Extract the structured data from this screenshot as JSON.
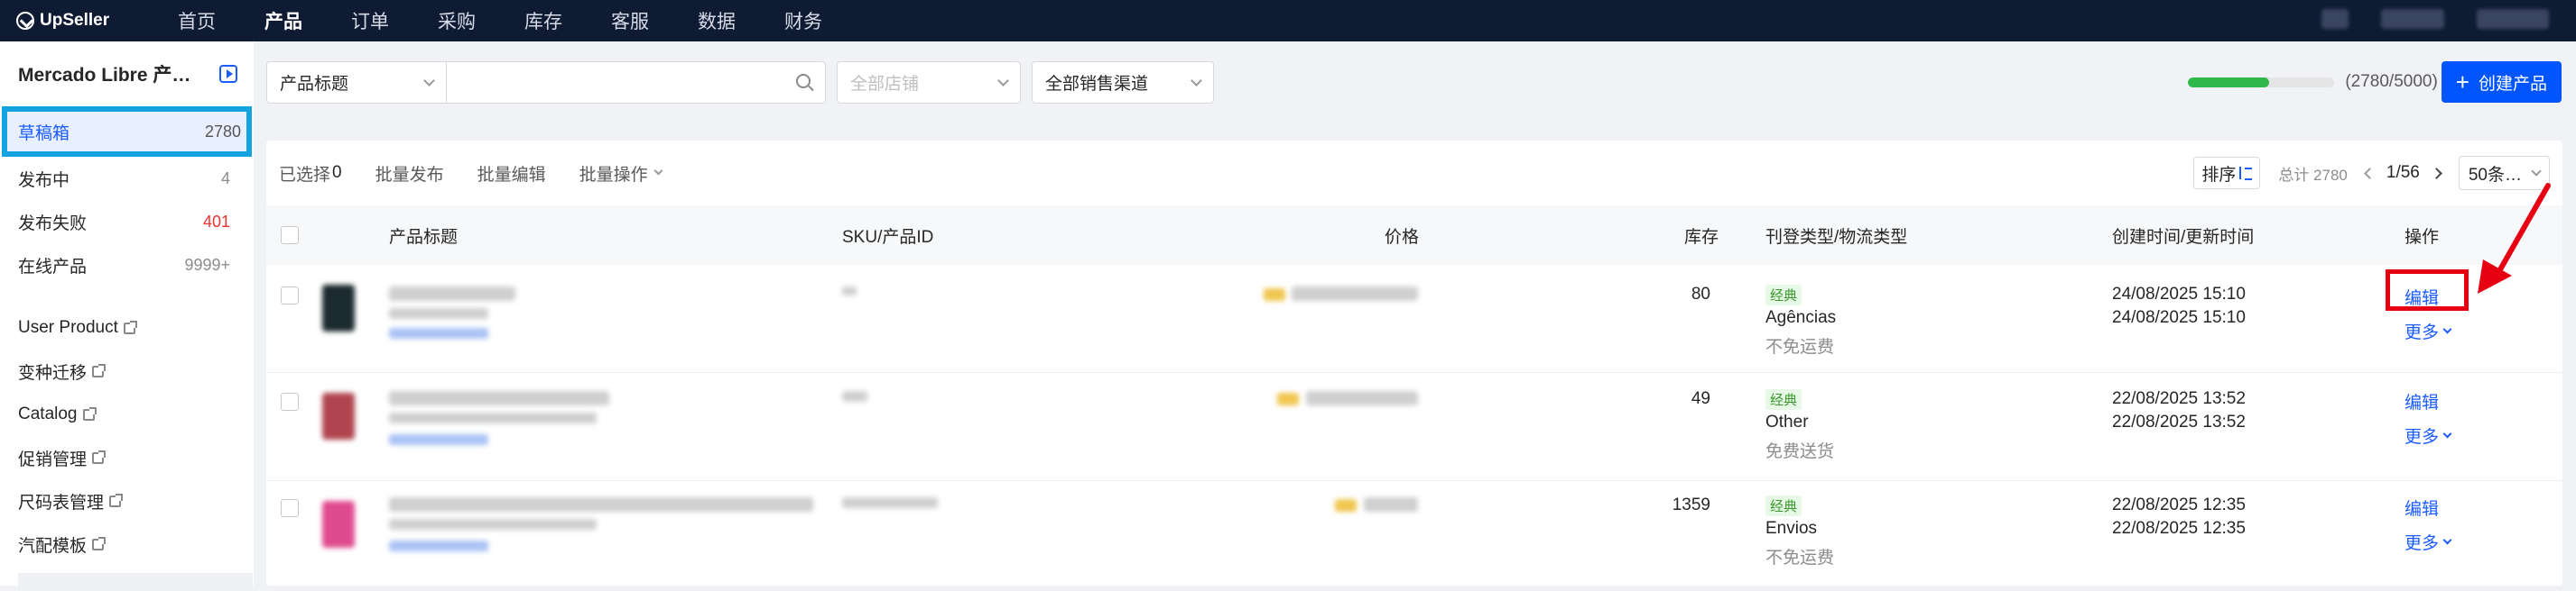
{
  "app": {
    "name": "UpSeller"
  },
  "nav": [
    {
      "label": "首页",
      "active": false
    },
    {
      "label": "产品",
      "active": true
    },
    {
      "label": "订单",
      "active": false
    },
    {
      "label": "采购",
      "active": false
    },
    {
      "label": "库存",
      "active": false
    },
    {
      "label": "客服",
      "active": false
    },
    {
      "label": "数据",
      "active": false
    },
    {
      "label": "财务",
      "active": false
    }
  ],
  "sidebar": {
    "shop_title": "Mercado Libre 产…",
    "statuses": [
      {
        "label": "草稿箱",
        "count": "2780",
        "active": true
      },
      {
        "label": "发布中",
        "count": "4"
      },
      {
        "label": "发布失败",
        "count": "401",
        "alert": true
      },
      {
        "label": "在线产品",
        "count": "9999+"
      }
    ],
    "links": [
      {
        "label": "User Product"
      },
      {
        "label": "变种迁移"
      },
      {
        "label": "Catalog"
      },
      {
        "label": "促销管理"
      },
      {
        "label": "尺码表管理"
      },
      {
        "label": "汽配模板"
      }
    ]
  },
  "filters": {
    "field_select": "产品标题",
    "search_placeholder": "",
    "store_placeholder": "全部店铺",
    "channel_select": "全部销售渠道"
  },
  "quota": {
    "text": "(2780/5000)",
    "fraction": 0.556
  },
  "create_button": {
    "label": "创建产品"
  },
  "toolbar": {
    "selected_label": "已选择",
    "selected_count": "0",
    "batch_publish": "批量发布",
    "batch_edit": "批量编辑",
    "batch_ops": "批量操作",
    "sort_label": "排序",
    "total": "总计 2780",
    "page": "1/56",
    "page_size": "50条…"
  },
  "columns": {
    "title": "产品标题",
    "sku": "SKU/产品ID",
    "price": "价格",
    "stock": "库存",
    "listing": "刊登类型/物流类型",
    "time": "创建时间/更新时间",
    "action": "操作"
  },
  "rows": [
    {
      "stock": "80",
      "listing_type": "经典",
      "logistics": "Agências",
      "shipping": "不免运费",
      "created": "24/08/2025 15:10",
      "updated": "24/08/2025 15:10",
      "edit": "编辑",
      "more": "更多",
      "thumb_color": "#1b2a2e"
    },
    {
      "stock": "49",
      "listing_type": "经典",
      "logistics": "Other",
      "shipping": "免费送货",
      "created": "22/08/2025 13:52",
      "updated": "22/08/2025 13:52",
      "edit": "编辑",
      "more": "更多",
      "thumb_color": "#b0454f"
    },
    {
      "stock": "1359",
      "listing_type": "经典",
      "logistics": "Envios",
      "shipping": "不免运费",
      "created": "22/08/2025 12:35",
      "updated": "22/08/2025 12:35",
      "edit": "编辑",
      "more": "更多",
      "thumb_color": "#e04a8f"
    }
  ],
  "colors": {
    "accent": "#0055ff",
    "topbar": "#0f1a33",
    "highlight": "#e60012",
    "sidebar_outline": "#13a3e0"
  }
}
